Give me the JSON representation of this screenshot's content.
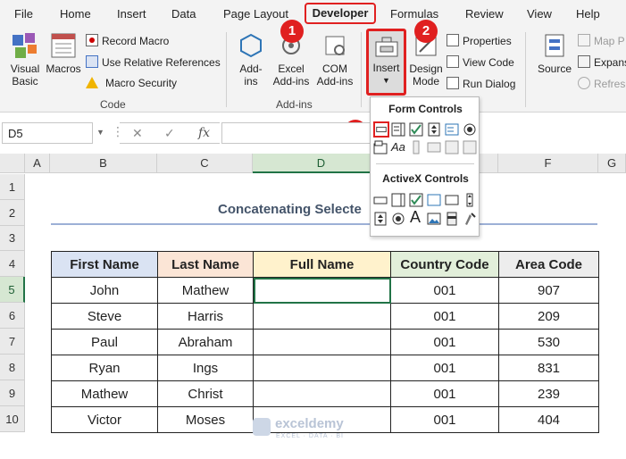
{
  "menu": {
    "tabs": [
      "File",
      "Home",
      "Insert",
      "Data",
      "Page Layout",
      "Developer",
      "Formulas",
      "Review",
      "View",
      "Help"
    ]
  },
  "ribbon": {
    "code": {
      "visual_basic": "Visual\nBasic",
      "macros": "Macros",
      "record_macro": "Record Macro",
      "relative_refs": "Use Relative References",
      "macro_security": "Macro Security",
      "label": "Code"
    },
    "addins": {
      "addins": "Add-\nins",
      "excel_addins": "Excel\nAdd-ins",
      "com_addins": "COM\nAdd-ins",
      "label": "Add-ins"
    },
    "controls": {
      "insert": "Insert",
      "design_mode": "Design\nMode",
      "properties": "Properties",
      "view_code": "View Code",
      "run_dialog": "Run Dialog"
    },
    "xml": {
      "source": "Source",
      "map_properties": "Map P",
      "expansion_packs": "Expans",
      "refresh_data": "Refresh"
    }
  },
  "badges": [
    "1",
    "2",
    "3"
  ],
  "formula_bar": {
    "name_box": "D5",
    "fx": "fx",
    "value": ""
  },
  "dropdown": {
    "form_controls_title": "Form Controls",
    "activex_title": "ActiveX Controls"
  },
  "grid": {
    "columns": [
      "A",
      "B",
      "C",
      "D",
      "E",
      "F",
      "G"
    ],
    "rows": [
      "1",
      "2",
      "3",
      "4",
      "5",
      "6",
      "7",
      "8",
      "9",
      "10"
    ],
    "title": "Concatenating Selecte",
    "headers": [
      "First Name",
      "Last Name",
      "Full Name",
      "Country Code",
      "Area Code"
    ],
    "records": [
      [
        "John",
        "Mathew",
        "",
        "001",
        "907"
      ],
      [
        "Steve",
        "Harris",
        "",
        "001",
        "209"
      ],
      [
        "Paul",
        "Abraham",
        "",
        "001",
        "530"
      ],
      [
        "Ryan",
        "Ings",
        "",
        "001",
        "831"
      ],
      [
        "Mathew",
        "Christ",
        "",
        "001",
        "239"
      ],
      [
        "Victor",
        "Moses",
        "",
        "001",
        "404"
      ]
    ]
  },
  "watermark": {
    "brand": "exceldemy",
    "tagline": "EXCEL · DATA · BI"
  },
  "colors": {
    "accent_red": "#e02020",
    "excel_green": "#217346"
  }
}
